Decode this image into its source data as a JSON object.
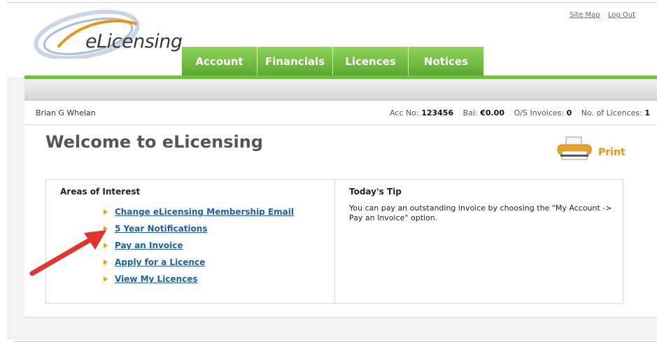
{
  "header": {
    "logo_text": "eLicensing",
    "top_links": {
      "site_map": "Site Map",
      "log_out": "Log Out"
    },
    "tabs": [
      "Account",
      "Financials",
      "Licences",
      "Notices"
    ],
    "accent_green": "#6fc23c",
    "logo_orange": "#e9950b"
  },
  "info": {
    "user_name": "Brian G Whelan",
    "acc_no_label": "Acc No:",
    "acc_no": "123456",
    "bal_label": "Bal:",
    "bal": "€0.00",
    "os_label": "O/S Invoices:",
    "os": "0",
    "licences_label": "No. of Licences:",
    "licences": "1"
  },
  "main": {
    "welcome_title": "Welcome to eLicensing",
    "print_label": "Print",
    "areas_title": "Areas of Interest",
    "links": [
      "Change eLicensing Membership Email",
      "5 Year Notifications",
      "Pay an Invoice",
      "Apply for a Licence",
      "View My Licences"
    ],
    "tip_title": "Today's Tip",
    "tip_text": "You can pay an outstanding invoice by choosing the \"My Account -> Pay an Invoice\" option."
  },
  "icons": [
    "logo-swoosh-icon",
    "printer-icon",
    "bullet-arrow-icon",
    "red-annotation-arrow-icon"
  ]
}
